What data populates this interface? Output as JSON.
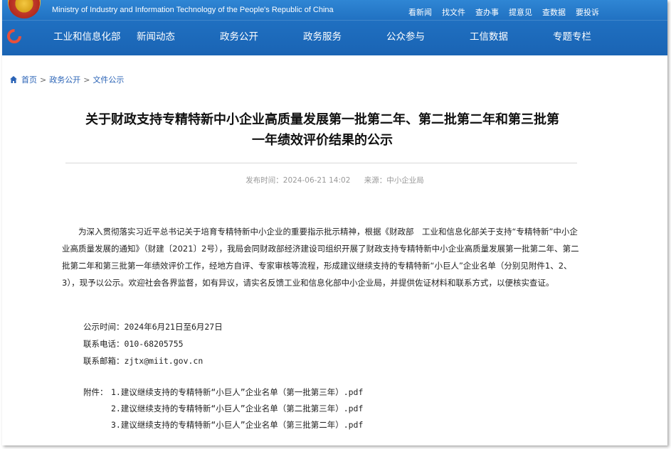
{
  "header": {
    "site_name_en": "Ministry of Industry and Information Technology of the People's Republic of China",
    "quick_links": [
      "看新闻",
      "找文件",
      "查办事",
      "提意见",
      "查数据",
      "要投诉"
    ],
    "nav": [
      "工业和信息化部",
      "新闻动态",
      "政务公开",
      "政务服务",
      "公众参与",
      "工信数据",
      "专题专栏"
    ],
    "colors": {
      "bar": "#1f6fc0",
      "link": "#2a63b6"
    }
  },
  "breadcrumb": {
    "home": "首页",
    "level1": "政务公开",
    "level2": "文件公示",
    "sep": ">"
  },
  "article": {
    "title_line1": "关于财政支持专精特新中小企业高质量发展第一批第二年、第二批第二年和第三批第",
    "title_line2": "一年绩效评价结果的公示",
    "publish_time": "发布时间：2024-06-21 14:02",
    "source": "来源：中小企业局",
    "paragraph": "为深入贯彻落实习近平总书记关于培育专精特新中小企业的重要指示批示精神，根据《财政部　工业和信息化部关于支持“专精特新”中小企业高质量发展的通知》（财建〔2021〕2号），我局会同财政部经济建设司组织开展了财政支持专精特新中小企业高质量发展第一批第二年、第二批第二年和第三批第一年绩效评价工作，经地方自评、专家审核等流程，形成建议继续支持的专精特新“小巨人”企业名单（分别见附件1、2、3），现予以公示。欢迎社会各界监督，如有异议，请实名反馈工业和信息化部中小企业局，并提供佐证材料和联系方式，以便核实查证。",
    "notice_period": "公示时间：2024年6月21日至6月27日",
    "phone": "联系电话：010-68205755",
    "email": "联系邮箱：zjtx@miit.gov.cn",
    "attachments_label": "附件：",
    "attachments": [
      "1.建议继续支持的专精特新“小巨人”企业名单（第一批第三年）.pdf",
      "2.建议继续支持的专精特新“小巨人”企业名单（第二批第三年）.pdf",
      "3.建议继续支持的专精特新“小巨人”企业名单（第三批第二年）.pdf"
    ]
  }
}
